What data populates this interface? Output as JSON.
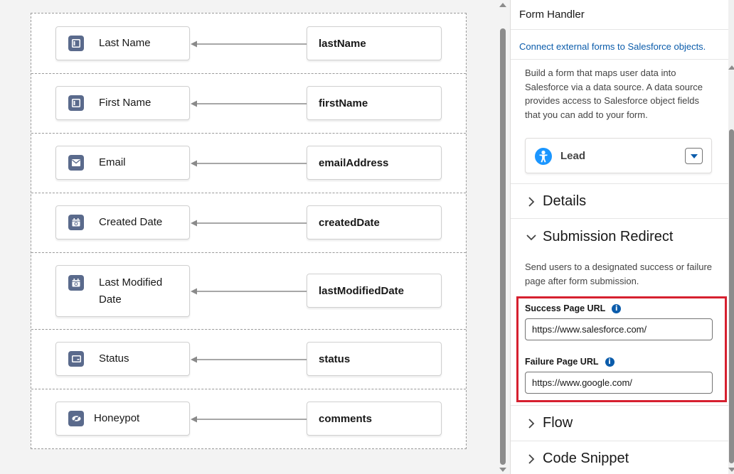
{
  "mappings": [
    {
      "field": "Last Name",
      "source": "lastName",
      "icon": "text-field-icon"
    },
    {
      "field": "First Name",
      "source": "firstName",
      "icon": "text-field-icon"
    },
    {
      "field": "Email",
      "source": "emailAddress",
      "icon": "email-icon"
    },
    {
      "field": "Created Date",
      "source": "createdDate",
      "icon": "calendar-icon"
    },
    {
      "field": "Last Modified Date",
      "source": "lastModifiedDate",
      "icon": "calendar-icon"
    },
    {
      "field": "Status",
      "source": "status",
      "icon": "picklist-icon"
    },
    {
      "field": "Honeypot",
      "source": "comments",
      "icon": "hidden-field-icon"
    }
  ],
  "panel": {
    "title": "Form Handler",
    "subtitle": "Connect external forms to Salesforce objects.",
    "description": "Build a form that maps user data into Salesforce via a data source. A data source provides access to Salesforce object fields that you can add to your form.",
    "object": {
      "label": "Lead",
      "icon": "lead-icon"
    },
    "sections": {
      "details": "Details",
      "submission_redirect": "Submission Redirect",
      "flow": "Flow",
      "code_snippet": "Code Snippet"
    },
    "redirect": {
      "description": "Send users to a designated success or failure page after form submission.",
      "success_label": "Success Page URL",
      "success_value": "https://www.salesforce.com/",
      "failure_label": "Failure Page URL",
      "failure_value": "https://www.google.com/"
    }
  },
  "colors": {
    "accent": "#0b5cab",
    "field_icon_bg": "#5a6a8c",
    "highlight": "#d6202f",
    "lead_icon": "#1b96ff"
  }
}
